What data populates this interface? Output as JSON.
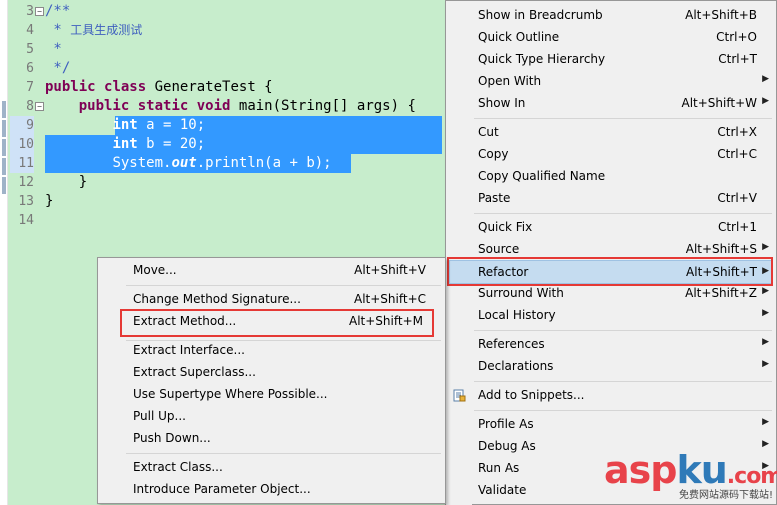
{
  "editor": {
    "line_numbers": [
      "3",
      "4",
      "5",
      "6",
      "7",
      "8",
      "9",
      "10",
      "11",
      "12",
      "13",
      "14"
    ],
    "code": {
      "l3": "/**",
      "l4_star": " * ",
      "l4_text": "工具生成测试",
      "l5": " *",
      "l6": " */",
      "l7_kw1": "public",
      "l7_kw2": "class",
      "l7_rest": " GenerateTest {",
      "l8_kw1": "public",
      "l8_kw2": "static",
      "l8_kw3": "void",
      "l8_rest": " main(String[] args) {",
      "l9_kw": "int",
      "l9_rest": " a = 10;",
      "l10_kw": "int",
      "l10_rest": " b = 20;",
      "l11_a": "System.",
      "l11_fld": "out",
      "l11_b": ".println(a + b);",
      "l12": "}",
      "l13": "}"
    },
    "colors": {
      "background": "#c7edcc",
      "keyword": "#7f0055",
      "comment": "#3f5fbf",
      "selection": "#3399ff"
    }
  },
  "context_menu": {
    "items": [
      {
        "label": "Show in Breadcrumb",
        "shortcut": "Alt+Shift+B"
      },
      {
        "label": "Quick Outline",
        "shortcut": "Ctrl+O"
      },
      {
        "label": "Quick Type Hierarchy",
        "shortcut": "Ctrl+T"
      },
      {
        "label": "Open With",
        "shortcut": ""
      },
      {
        "label": "Show In",
        "shortcut": "Alt+Shift+W"
      },
      {
        "label": "Cut",
        "shortcut": "Ctrl+X"
      },
      {
        "label": "Copy",
        "shortcut": "Ctrl+C"
      },
      {
        "label": "Copy Qualified Name",
        "shortcut": ""
      },
      {
        "label": "Paste",
        "shortcut": "Ctrl+V"
      },
      {
        "label": "Quick Fix",
        "shortcut": "Ctrl+1"
      },
      {
        "label": "Source",
        "shortcut": "Alt+Shift+S"
      },
      {
        "label": "Refactor",
        "shortcut": "Alt+Shift+T"
      },
      {
        "label": "Surround With",
        "shortcut": "Alt+Shift+Z"
      },
      {
        "label": "Local History",
        "shortcut": ""
      },
      {
        "label": "References",
        "shortcut": ""
      },
      {
        "label": "Declarations",
        "shortcut": ""
      },
      {
        "label": "Add to Snippets...",
        "shortcut": ""
      },
      {
        "label": "Profile As",
        "shortcut": ""
      },
      {
        "label": "Debug As",
        "shortcut": ""
      },
      {
        "label": "Run As",
        "shortcut": ""
      },
      {
        "label": "Validate",
        "shortcut": ""
      }
    ],
    "highlighted": "Refactor"
  },
  "refactor_submenu": {
    "items": [
      {
        "label": "Move...",
        "shortcut": "Alt+Shift+V"
      },
      {
        "label": "Change Method Signature...",
        "shortcut": "Alt+Shift+C"
      },
      {
        "label": "Extract Method...",
        "shortcut": "Alt+Shift+M"
      },
      {
        "label": "Extract Interface...",
        "shortcut": ""
      },
      {
        "label": "Extract Superclass...",
        "shortcut": ""
      },
      {
        "label": "Use Supertype Where Possible...",
        "shortcut": ""
      },
      {
        "label": "Pull Up...",
        "shortcut": ""
      },
      {
        "label": "Push Down...",
        "shortcut": ""
      },
      {
        "label": "Extract Class...",
        "shortcut": ""
      },
      {
        "label": "Introduce Parameter Object...",
        "shortcut": ""
      }
    ],
    "emphasized": "Extract Method..."
  },
  "watermark": {
    "part1": "asp",
    "part2": "ku",
    "part3": ".com",
    "subtitle": "免费网站源码下载站!"
  },
  "accent": {
    "highlight_box": "#e53935",
    "menu_hover": "#c5dcf0"
  }
}
